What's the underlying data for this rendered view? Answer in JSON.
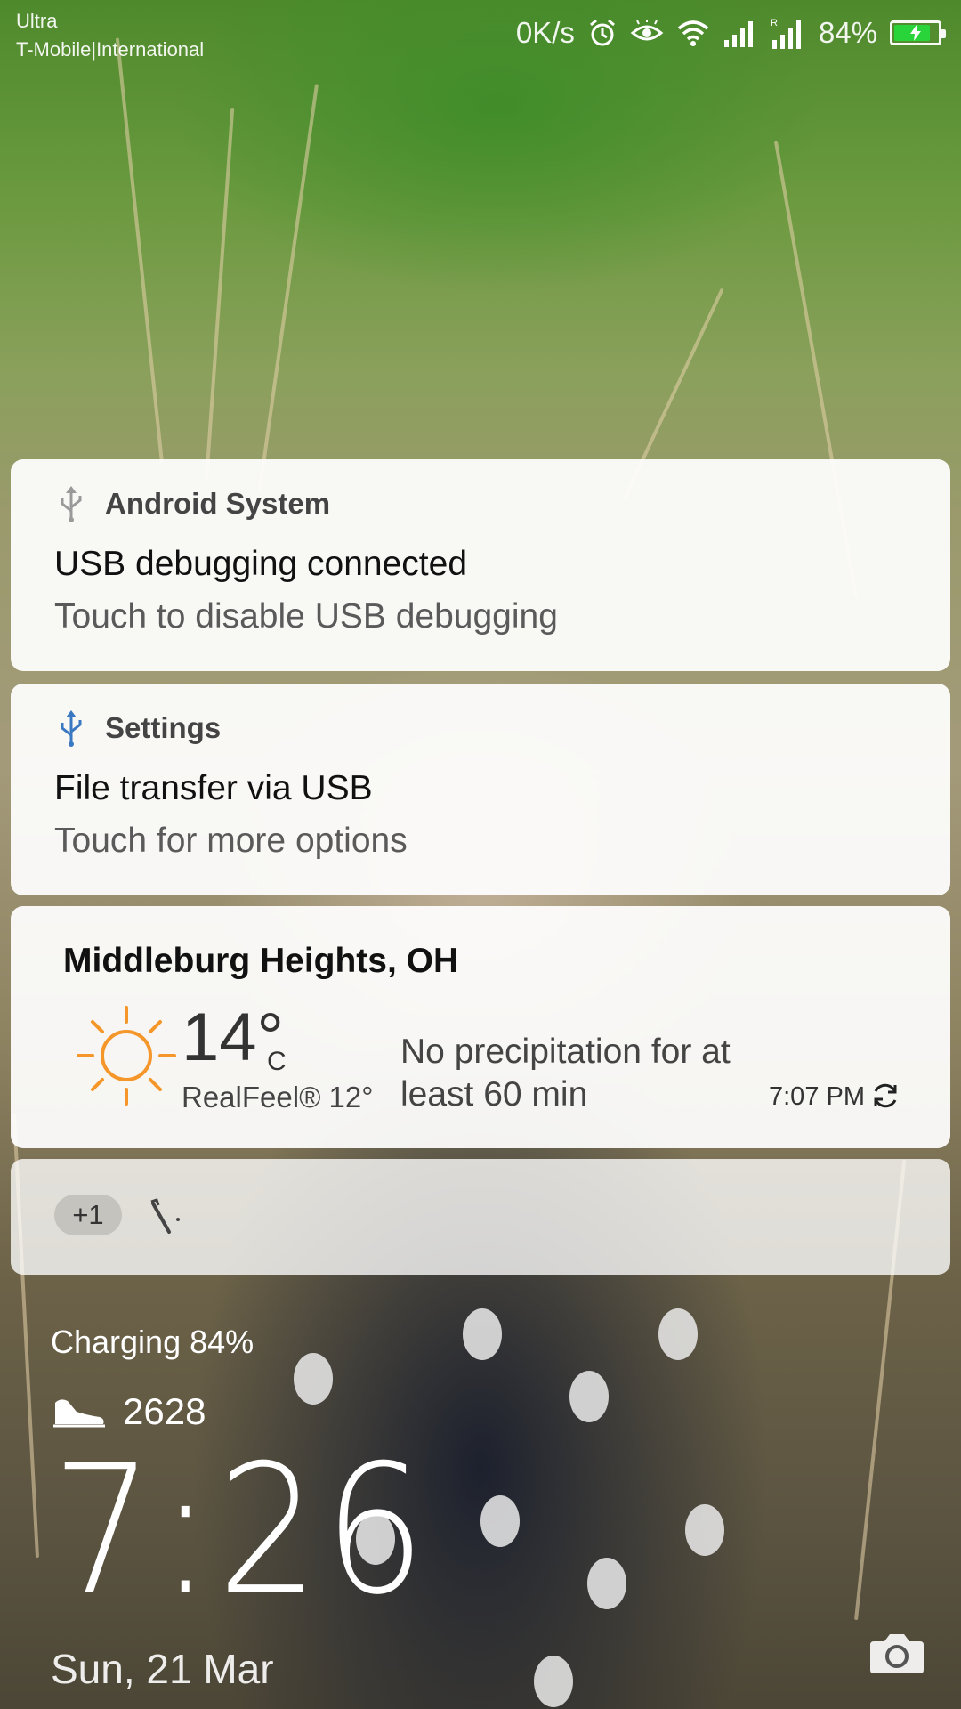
{
  "status_bar": {
    "carrier_line1": "Ultra",
    "carrier_line2": "T-Mobile|International",
    "network_speed": "0K/s",
    "battery_percent": "84%",
    "battery_level": 0.84,
    "battery_color": "#29d43a",
    "icons": [
      "alarm-icon",
      "eye-comfort-icon",
      "wifi-icon",
      "signal-icon",
      "signal-roaming-icon",
      "battery-charging-icon"
    ]
  },
  "notifications": [
    {
      "app": "Android System",
      "icon": "usb-icon",
      "title": "USB debugging connected",
      "text": "Touch to disable USB debugging"
    },
    {
      "app": "Settings",
      "icon": "usb-icon",
      "title": "File transfer via USB",
      "text": "Touch for more options"
    }
  ],
  "weather": {
    "city": "Middleburg Heights, OH",
    "temperature": "14°",
    "unit": "C",
    "realfeel": "RealFeel® 12°",
    "description": "No precipitation for at least 60 min",
    "updated_time": "7:07 PM",
    "icon": "sun-icon",
    "sun_color": "#f5962a"
  },
  "more_notifications": {
    "count": "+1",
    "icon": "tool-icon"
  },
  "lockscreen": {
    "charging": "Charging 84%",
    "steps": "2628",
    "time": "7:26",
    "date": "Sun, 21 Mar"
  }
}
